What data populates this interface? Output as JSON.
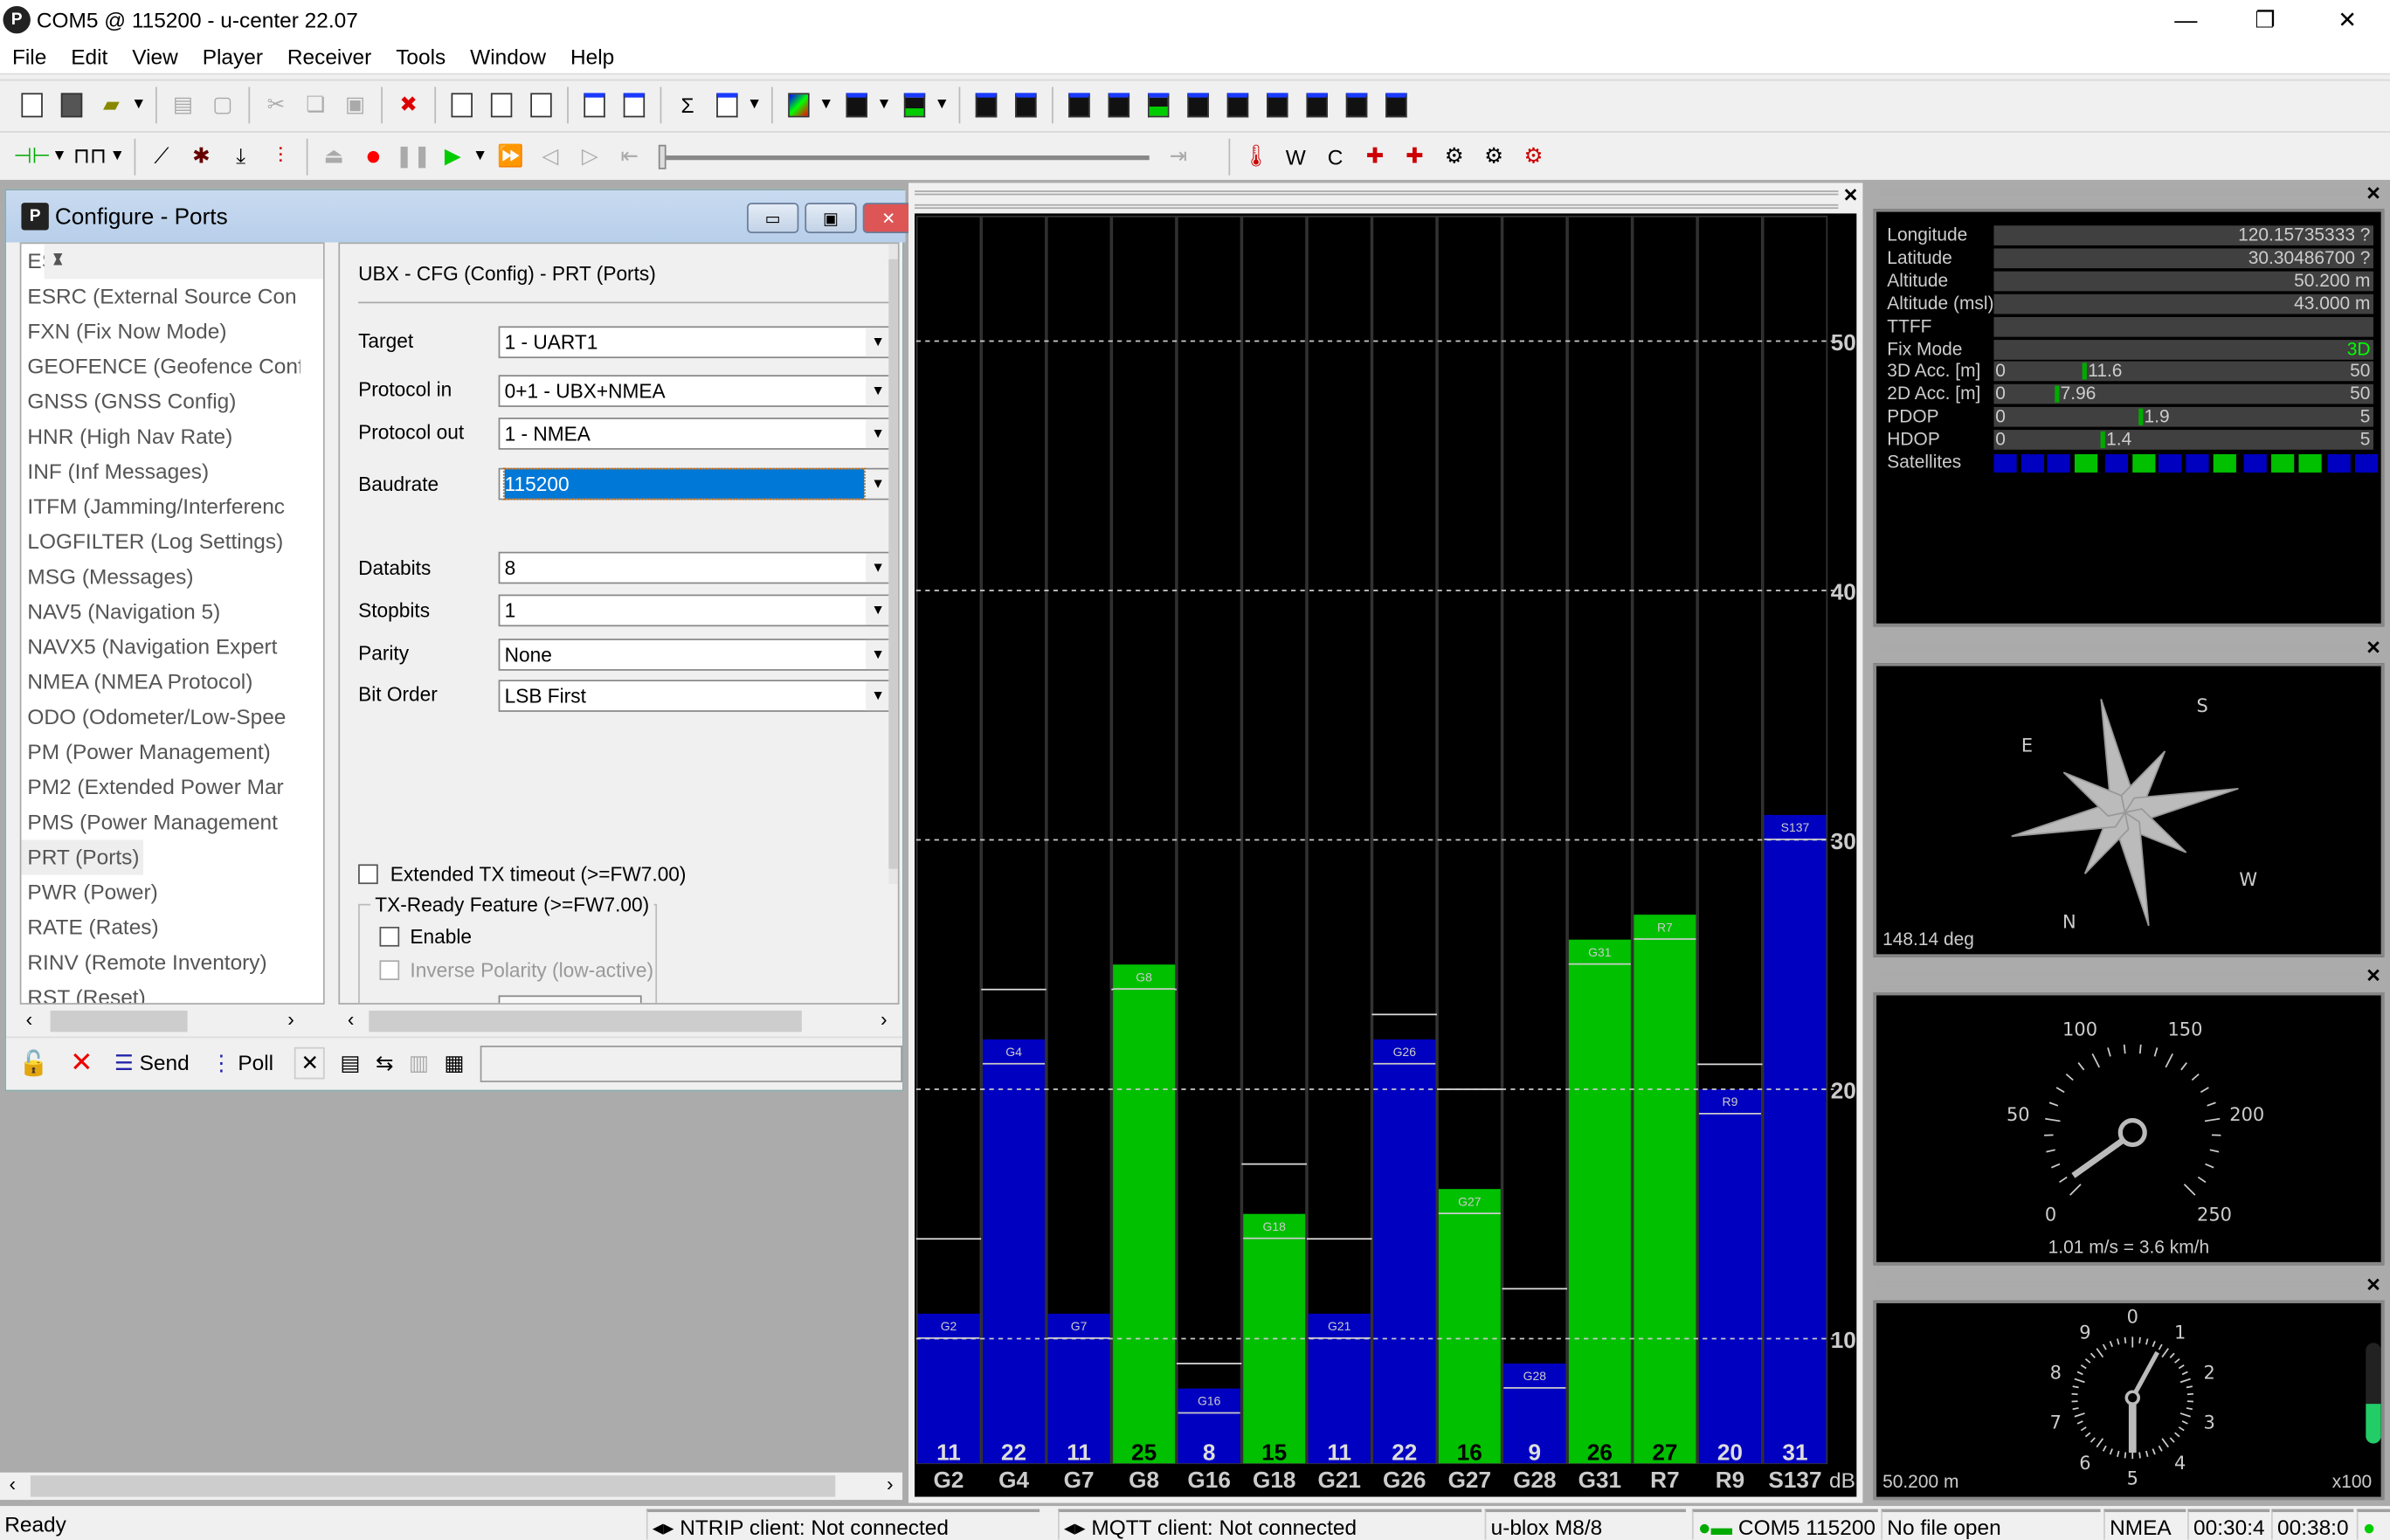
{
  "window": {
    "title": "COM5 @ 115200 - u-center 22.07",
    "logo": "P"
  },
  "menu": [
    "File",
    "Edit",
    "View",
    "Player",
    "Receiver",
    "Tools",
    "Window",
    "Help"
  ],
  "config": {
    "title": "Configure - Ports",
    "list": [
      "ESFWT (Wheel-Tick Config)",
      "ESRC (External Source Con",
      "FXN (Fix Now Mode)",
      "GEOFENCE (Geofence Conf",
      "GNSS (GNSS Config)",
      "HNR (High Nav Rate)",
      "INF (Inf Messages)",
      "ITFM (Jamming/Interferenc",
      "LOGFILTER (Log Settings)",
      "MSG (Messages)",
      "NAV5 (Navigation 5)",
      "NAVX5 (Navigation Expert",
      "NMEA (NMEA Protocol)",
      "ODO (Odometer/Low-Spee",
      "PM (Power Management)",
      "PM2 (Extended Power Mar",
      "PMS (Power Management",
      "PRT (Ports)",
      "PWR (Power)",
      "RATE (Rates)",
      "RINV (Remote Inventory)",
      "RST (Reset)"
    ],
    "selected": "PRT (Ports)",
    "header": "UBX - CFG (Config) - PRT (Ports)",
    "fields": {
      "target": {
        "label": "Target",
        "value": "1 - UART1"
      },
      "protocol_in": {
        "label": "Protocol in",
        "value": "0+1 - UBX+NMEA"
      },
      "protocol_out": {
        "label": "Protocol out",
        "value": "1 - NMEA"
      },
      "baudrate": {
        "label": "Baudrate",
        "value": "115200"
      },
      "databits": {
        "label": "Databits",
        "value": "8"
      },
      "stopbits": {
        "label": "Stopbits",
        "value": "1"
      },
      "parity": {
        "label": "Parity",
        "value": "None"
      },
      "bit_order": {
        "label": "Bit Order",
        "value": "LSB First"
      }
    },
    "extended_tx": {
      "label": "Extended TX timeout (>=FW7.00)",
      "checked": false
    },
    "tx_ready": {
      "group": "TX-Ready Feature (>=FW7.00)",
      "enable": "Enable",
      "inverse": "Inverse Polarity (low-active)"
    },
    "send": "Send",
    "poll": "Poll"
  },
  "chart_data": {
    "type": "bar",
    "categories": [
      "G2",
      "G4",
      "G7",
      "G8",
      "G16",
      "G18",
      "G21",
      "G26",
      "G27",
      "G28",
      "G31",
      "R7",
      "R9",
      "S137"
    ],
    "values": [
      11,
      22,
      11,
      25,
      8,
      15,
      11,
      22,
      16,
      9,
      26,
      27,
      20,
      31
    ],
    "used_in_fix": [
      false,
      false,
      false,
      true,
      false,
      true,
      false,
      false,
      true,
      false,
      true,
      true,
      false,
      false
    ],
    "marker_values": [
      14,
      24,
      null,
      24,
      9,
      17,
      14,
      23,
      20,
      12,
      null,
      null,
      21,
      null
    ],
    "yticks": [
      10,
      20,
      30,
      40,
      50
    ],
    "ylim": [
      5,
      55
    ],
    "yunit": "dB",
    "grid": true,
    "colors": {
      "used": "#00c000",
      "unused": "#0000c0"
    }
  },
  "info": {
    "rows": [
      {
        "label": "Longitude",
        "value": "120.15735333 ?"
      },
      {
        "label": "Latitude",
        "value": "30.30486700 ?"
      },
      {
        "label": "Altitude",
        "value": "50.200 m"
      },
      {
        "label": "Altitude (msl)",
        "value": "43.000 m"
      },
      {
        "label": "TTFF",
        "value": ""
      },
      {
        "label": "Fix Mode",
        "value": "3D"
      }
    ],
    "gauges": [
      {
        "label": "3D Acc. [m]",
        "min": "0",
        "max": "50",
        "value": "11.6"
      },
      {
        "label": "2D Acc. [m]",
        "min": "0",
        "max": "50",
        "value": "7.96"
      },
      {
        "label": "PDOP",
        "min": "0",
        "max": "5",
        "value": "1.9"
      },
      {
        "label": "HDOP",
        "min": "0",
        "max": "5",
        "value": "1.4"
      }
    ],
    "satellites_label": "Satellites",
    "satellites": [
      "b",
      "b",
      "b",
      "g",
      "b",
      "g",
      "b",
      "b",
      "g",
      "b",
      "g",
      "g",
      "b",
      "b"
    ]
  },
  "compass": {
    "heading": "148.14 deg",
    "labels": {
      "N": "N",
      "E": "E",
      "S": "S",
      "W": "W"
    }
  },
  "speedometer": {
    "ticks": [
      "0",
      "50",
      "100",
      "150",
      "200",
      "250"
    ],
    "readout": "1.01 m/s = 3.6 km/h",
    "needle_kmh": 3.6
  },
  "altimeter": {
    "digits": [
      "0",
      "1",
      "2",
      "3",
      "4",
      "5",
      "6",
      "7",
      "8",
      "9"
    ],
    "readout": "50.200 m",
    "scale": "x100",
    "level": 0.4
  },
  "status": {
    "ready": "Ready",
    "ntrip": "NTRIP client: Not connected",
    "mqtt": "MQTT client: Not connected",
    "receiver": "u-blox M8/8",
    "port": "COM5 115200",
    "file": "No file open",
    "protocol": "NMEA",
    "time1": "00:30:4",
    "time2": "00:38:0"
  }
}
